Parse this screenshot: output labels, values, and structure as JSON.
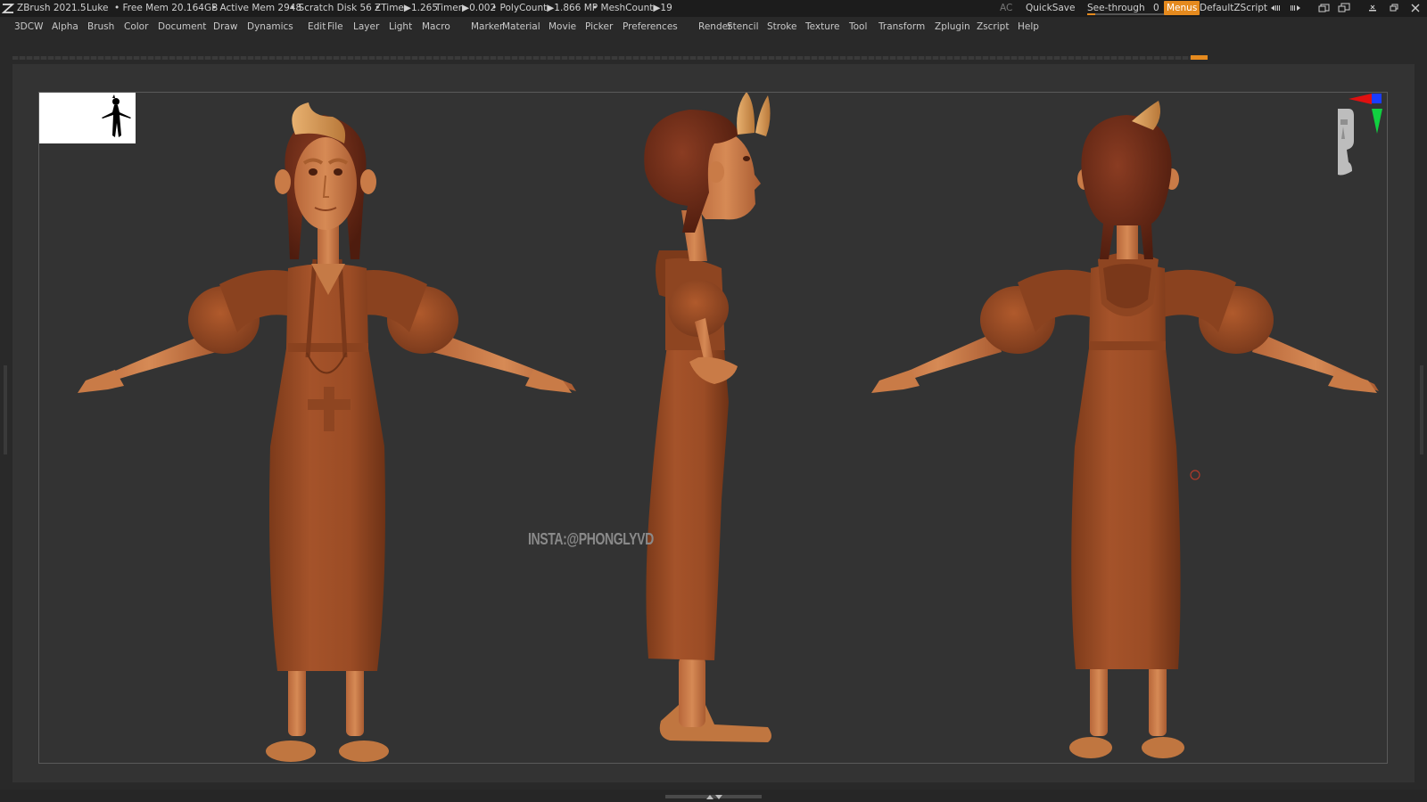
{
  "titlebar": {
    "app": "ZBrush 2021.5",
    "project": "Luke",
    "free_mem": "• Free Mem 20.164GB",
    "active_mem": "• Active Mem 2948",
    "scratch_disk": "• Scratch Disk 56 •",
    "ztime": "ZTime▶1.265",
    "timer": "Timer▶0.002",
    "polycount": "• PolyCount▶1.866 MP",
    "meshcount": "• MeshCount▶19",
    "ac": "AC",
    "quicksave": "QuickSave",
    "see_through_label": "See-through",
    "see_through_value": "0",
    "see_through_level": 0,
    "menus": "Menus",
    "script": "DefaultZScript"
  },
  "menubar": {
    "items": [
      "3DCW",
      "Alpha",
      "Brush",
      "Color",
      "Document",
      "Draw",
      "Dynamics",
      "Edit",
      "File",
      "Layer",
      "Light",
      "Macro",
      "Marker",
      "Material",
      "Movie",
      "Picker",
      "Preferences",
      "Render",
      "Stencil",
      "Stroke",
      "Texture",
      "Tool",
      "Transform",
      "Zplugin",
      "Zscript",
      "Help"
    ]
  },
  "canvas": {
    "watermark": "INSTA:@PHONGLYVD",
    "model_views": [
      "front",
      "side",
      "back"
    ]
  },
  "colors": {
    "accent": "#e58a1e",
    "clay": "#a0522d",
    "background": "#333333"
  },
  "icons": {
    "logo": "zbrush-logo-icon",
    "gizmo": "axis-gizmo-icon",
    "head": "orientation-head-icon"
  }
}
